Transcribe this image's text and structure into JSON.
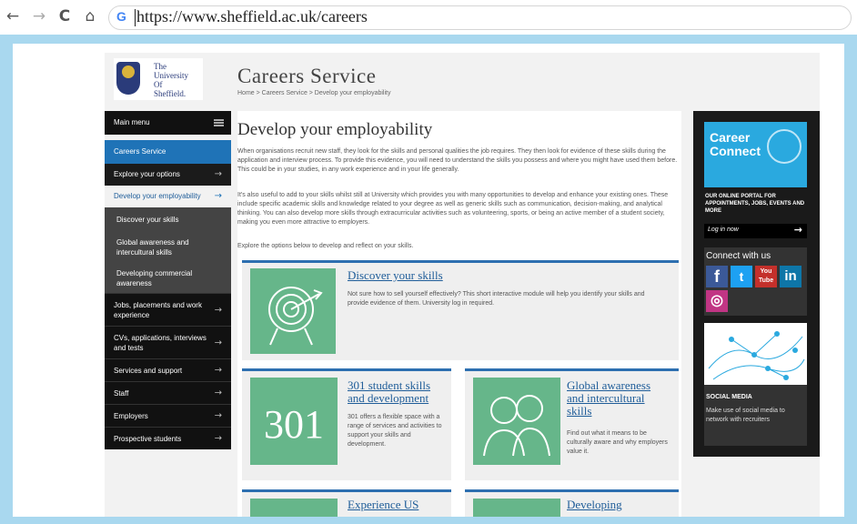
{
  "browser": {
    "url": "https://www.sheffield.ac.uk/careers",
    "back": "←",
    "forward": "→",
    "reload": "C",
    "home": "⌂",
    "g": "G"
  },
  "logo": {
    "line1": "The",
    "line2": "University",
    "line3": "Of",
    "line4": "Sheffield."
  },
  "header": {
    "title": "Careers Service",
    "breadcrumb": "Home > Careers Service > Develop your employability"
  },
  "sidebar": {
    "main_menu": "Main menu",
    "careers_service": "Careers Service",
    "explore": "Explore your options",
    "develop": "Develop your employability",
    "sub": [
      "Discover your skills",
      "Global awareness and intercultural skills",
      "Developing commercial awareness"
    ],
    "items": [
      "Jobs, placements and work experience",
      "CVs, applications, interviews and tests",
      "Services and support",
      "Staff",
      "Employers",
      "Prospective students"
    ],
    "arrow": "→"
  },
  "content": {
    "title": "Develop your employability",
    "p1": "When organisations recruit new staff, they look for the skills and personal qualities the job requires. They then look for evidence of these skills during the application and interview process. To provide this evidence, you will need to understand the skills you possess and where you might have used them before. This could be in your studies, in any work experience and in your life generally.",
    "p2": "It's also useful to add to your skills whilst still at University which provides you with many opportunities to develop and enhance your existing ones. These include specific academic skills and knowledge related to your degree as well as generic skills such as communication, decision-making, and analytical thinking. You can also develop more skills through extracurricular activities such as volunteering, sports, or being an active member of a student society, making you even more attractive to employers.",
    "p3": "Explore the options below to develop and reflect on your skills."
  },
  "cards": {
    "discover": {
      "title": "Discover your skills",
      "text": "Not sure how to sell yourself effectively? This short interactive module will help you identify your skills and provide evidence of them. University log in required."
    },
    "s301": {
      "number": "301",
      "title": "301 student skills and development",
      "text": "301 offers a flexible space with a range of services and activities to support your skills and development."
    },
    "global": {
      "title": "Global awareness and intercultural skills",
      "text": "Find out what it means to be culturally aware and why employers value it."
    },
    "experience": {
      "title": "Experience US"
    },
    "developing": {
      "title": "Developing"
    }
  },
  "right": {
    "career_connect": "Career Connect",
    "portal_text": "OUR ONLINE PORTAL FOR APPOINTMENTS, JOBS, EVENTS AND MORE",
    "login": "Log in now",
    "login_arrow": "→",
    "connect_title": "Connect with us",
    "social": {
      "facebook": "f",
      "twitter": "t",
      "youtube": "You Tube",
      "linkedin": "in",
      "instagram": "◎"
    },
    "media_title": "SOCIAL MEDIA",
    "media_text": "Make use of social media to network with recruiters"
  },
  "colors": {
    "accent": "#1f73b7",
    "green": "#66b68a",
    "frame": "#a9d8ef"
  }
}
